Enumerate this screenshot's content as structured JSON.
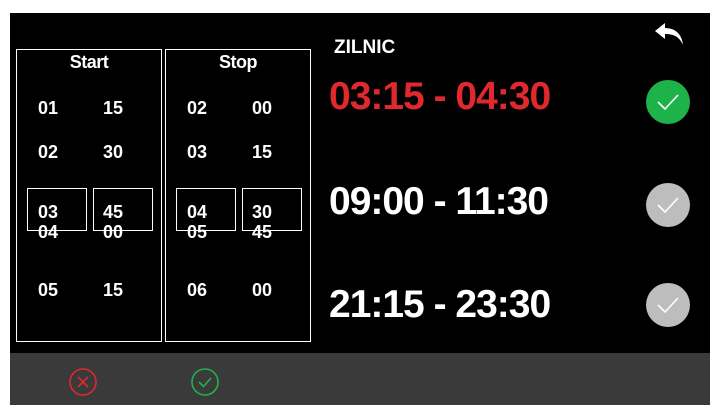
{
  "start_picker": {
    "title": "Start",
    "hours": [
      "01",
      "02",
      "03",
      "04",
      "05"
    ],
    "minutes": [
      "15",
      "30",
      "45",
      "00",
      "15"
    ]
  },
  "stop_picker": {
    "title": "Stop",
    "hours": [
      "02",
      "03",
      "04",
      "05",
      "06"
    ],
    "minutes": [
      "00",
      "15",
      "30",
      "45",
      "00"
    ]
  },
  "zone": {
    "title": "ZILNIC"
  },
  "intervals": [
    {
      "text": "03:15 - 04:30",
      "color": "#e0282f",
      "active": true,
      "check_color": "#1db34a"
    },
    {
      "text": "09:00 - 11:30",
      "color": "#ffffff",
      "active": false,
      "check_color": "#bdbdbd"
    },
    {
      "text": "21:15 - 23:30",
      "color": "#ffffff",
      "active": false,
      "check_color": "#bdbdbd"
    }
  ],
  "icons": {
    "back": "back-arrow-icon",
    "cancel": "cancel-circle-x-icon",
    "confirm": "confirm-circle-check-icon"
  },
  "colors": {
    "background": "#000000",
    "footer": "#3a3a3a",
    "cancel": "#e0282f",
    "confirm": "#22b14c"
  }
}
